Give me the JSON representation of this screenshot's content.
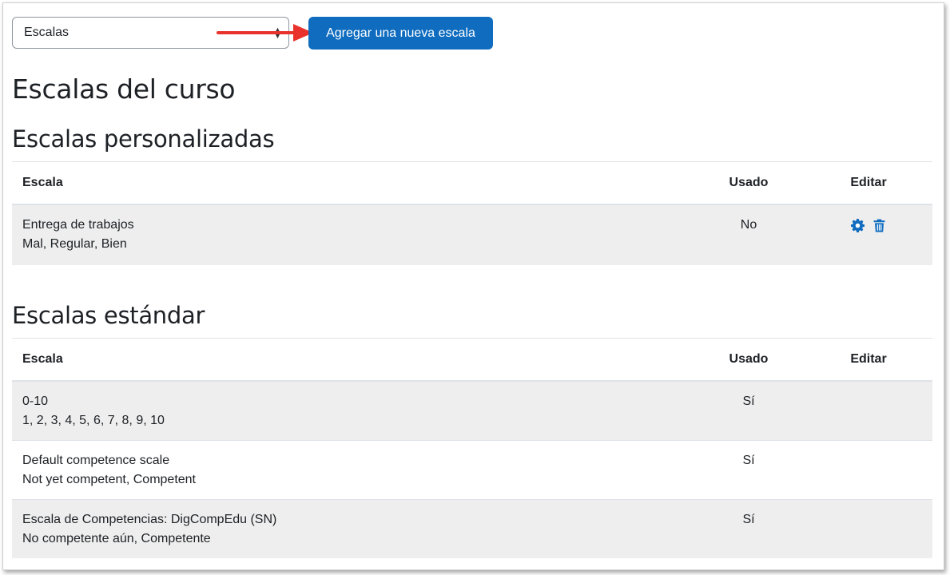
{
  "toolbar": {
    "select_value": "Escalas",
    "add_button": "Agregar una nueva escala"
  },
  "page_title": "Escalas del curso",
  "custom": {
    "title": "Escalas personalizadas",
    "headers": {
      "scale": "Escala",
      "used": "Usado",
      "edit": "Editar"
    },
    "rows": [
      {
        "name": "Entrega de trabajos",
        "items": "Mal, Regular, Bien",
        "used": "No",
        "icons": [
          "gear-icon",
          "trash-icon"
        ]
      }
    ]
  },
  "standard": {
    "title": "Escalas estándar",
    "headers": {
      "scale": "Escala",
      "used": "Usado",
      "edit": "Editar"
    },
    "rows": [
      {
        "name": "0-10",
        "items": "1, 2, 3, 4, 5, 6, 7, 8, 9, 10",
        "used": "Sí"
      },
      {
        "name": "Default competence scale",
        "items": "Not yet competent, Competent",
        "used": "Sí"
      },
      {
        "name": "Escala de Competencias: DigCompEdu (SN)",
        "items": "No competente aún, Competente",
        "used": "Sí"
      }
    ]
  },
  "colors": {
    "primary": "#0f6cbf",
    "arrow": "#e8322b",
    "stripe": "#eeeeee"
  }
}
